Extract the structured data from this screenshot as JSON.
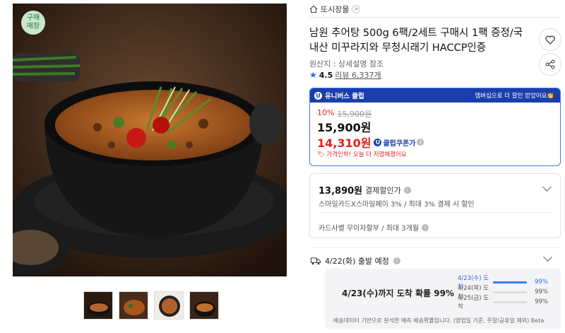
{
  "badge": "구매\n매장",
  "store": {
    "name": "또시장몰",
    "chevron": ">"
  },
  "product": {
    "title": "남원 추어탕 500g 6팩/2세트 구매시 1팩 증정/국내산 미꾸라지와 무청시래기 HACCP인증",
    "origin": "원산지 : 상세설명 참조",
    "rating": "4.5",
    "reviews": "리뷰 6,337개"
  },
  "icons": {
    "wish": "heart-icon",
    "share": "share-icon",
    "store": "home-icon",
    "ship": "truck-icon"
  },
  "club": {
    "logo": "U",
    "label": "유니버스 클럽",
    "promo": "멤버십으로 더 할인 받았어요👏"
  },
  "price": {
    "discount_pct": "10%",
    "original": "15,900원",
    "current": "15,900원",
    "club_price": "14,310원",
    "coupon_label": "클럽쿠폰가",
    "note": "가격인하! 오늘 더 저렴해졌어요"
  },
  "card": {
    "amount": "13,890원",
    "amount_label": "결제할인가",
    "line1": "스마일카드X스마일페이 3% / 최대 3% 결제 시 할인",
    "line2": "카드사별 무이자할부 / 최대 3개월"
  },
  "shipping": {
    "head": "4/22(화) 출발 예정",
    "big": "4/23(수)까지 도착 확률 99%",
    "rows": [
      {
        "date": "4/23(수) 도착",
        "pct": "99%",
        "fill": 0.99
      },
      {
        "date": "4/24(목) 도착",
        "pct": "99%",
        "fill": 0
      },
      {
        "date": "4/25(금) 도착",
        "pct": "99%",
        "fill": 0
      }
    ],
    "note": "배송데이터 기반으로 분석한 예측 배송확률입니다. (영업일 기준, 주말/공휴일 제외) Beta"
  }
}
